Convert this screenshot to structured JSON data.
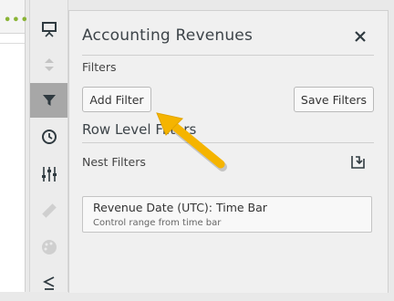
{
  "canvas": {
    "menu_dots": "•••"
  },
  "rail": {
    "items": [
      {
        "icon": "presentation-icon",
        "active": false
      },
      {
        "icon": "sort-arrows-icon",
        "active": false
      },
      {
        "icon": "filter-icon",
        "active": true
      },
      {
        "icon": "clock-icon",
        "active": false
      },
      {
        "icon": "sliders-icon",
        "active": false
      },
      {
        "icon": "ruler-icon",
        "active": false
      },
      {
        "icon": "palette-icon",
        "active": false
      },
      {
        "icon": "less-equal-icon",
        "active": false
      }
    ]
  },
  "panel": {
    "title": "Accounting Revenues",
    "filters_label": "Filters",
    "add_filter_label": "Add Filter",
    "save_filters_label": "Save Filters",
    "row_level_filters_label": "Row Level Filters",
    "nest_filters_label": "Nest Filters",
    "filter_card": {
      "title": "Revenue Date (UTC): Time Bar",
      "subtitle": "Control range from time bar"
    }
  },
  "colors": {
    "active_rail": "#a7a7a7",
    "arrow": "#f5b400",
    "dots": "#8ab436"
  }
}
